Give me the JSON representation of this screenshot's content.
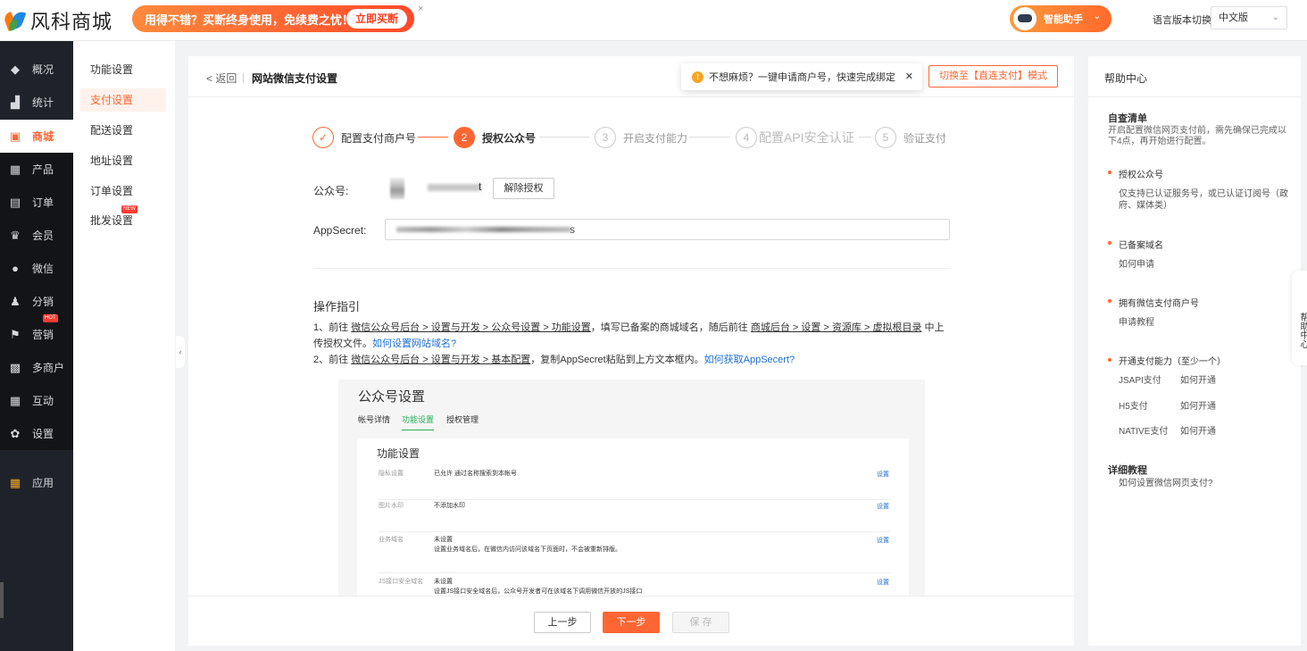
{
  "header": {
    "logo_text": "风科商城",
    "promo_text": "用得不错？买断终身使用，免续费之忧！",
    "promo_button": "立即买断",
    "promo_close": "×",
    "assistant_label": "智能助手",
    "language_label": "语言版本切换：",
    "language_value": "中文版"
  },
  "sidebar": {
    "items": [
      {
        "label": "概况",
        "icon": "◆"
      },
      {
        "label": "统计",
        "icon": "▟"
      },
      {
        "label": "商城",
        "icon": "▣"
      },
      {
        "label": "产品",
        "icon": "▦"
      },
      {
        "label": "订单",
        "icon": "▤"
      },
      {
        "label": "会员",
        "icon": "♛"
      },
      {
        "label": "微信",
        "icon": "●"
      },
      {
        "label": "分销",
        "icon": "♟"
      },
      {
        "label": "营销",
        "icon": "⚑",
        "badge": "HOT"
      },
      {
        "label": "多商户",
        "icon": "▩"
      },
      {
        "label": "互动",
        "icon": "▦"
      },
      {
        "label": "设置",
        "icon": "✿"
      },
      {
        "label": "应用",
        "icon": "▦"
      }
    ]
  },
  "subnav": {
    "items": [
      {
        "label": "功能设置"
      },
      {
        "label": "支付设置"
      },
      {
        "label": "配送设置"
      },
      {
        "label": "地址设置"
      },
      {
        "label": "订单设置"
      },
      {
        "label": "批发设置",
        "badge": "NEW"
      }
    ]
  },
  "main": {
    "back": "< 返回",
    "separator": "|",
    "title": "网站微信支付设置",
    "tip_icon": "!",
    "tip_text": "不想麻烦？一键申请商户号，快速完成绑定",
    "tip_close": "✕",
    "switch_button": "切换至【直连支付】模式",
    "steps": [
      {
        "num": "✓",
        "label": "配置支付商户号"
      },
      {
        "num": "2",
        "label": "授权公众号"
      },
      {
        "num": "3",
        "label": "开启支付能力"
      },
      {
        "num": "4",
        "label": "配置API安全认证"
      },
      {
        "num": "5",
        "label": "验证支付"
      }
    ],
    "form": {
      "account_label": "公众号:",
      "account_name_tail": "t",
      "unbind_button": "解除授权",
      "secret_label": "AppSecret:",
      "secret_tail": "s"
    },
    "guide": {
      "title": "操作指引",
      "line1_prefix": "1、前往",
      "line1_link1": "微信公众号后台 > 设置与开发 > 公众号设置 > 功能设置",
      "line1_mid": "，填写已备案的商城域名，随后前往",
      "line1_link2": "商城后台 > 设置 > 资源库 > 虚拟根目录",
      "line1_suffix": "中上",
      "line1b_text": "传授权文件。",
      "line1b_link": "如何设置网站域名?",
      "line2_prefix": "2、前往",
      "line2_link1": "微信公众号后台 > 设置与开发 > 基本配置",
      "line2_mid": "，复制AppSecret粘贴到上方文本框内。",
      "line2_link2": "如何获取AppSecert?"
    },
    "screenshot": {
      "title": "公众号设置",
      "tabs": [
        "帐号详情",
        "功能设置",
        "授权管理"
      ],
      "card_title": "功能设置",
      "rows": [
        {
          "key": "隐私设置",
          "value": "已允许 通过名称搜索到本帐号",
          "value2": "",
          "action": "设置"
        },
        {
          "key": "图片水印",
          "value": "不添加水印",
          "value2": "",
          "action": "设置"
        },
        {
          "key": "业务域名",
          "value": "未设置",
          "value2": "设置业务域名后，在微信内访问该域名下页面时，不会被重新排版。",
          "action": "设置"
        },
        {
          "key": "JS接口安全域名",
          "value": "未设置",
          "value2": "设置JS接口安全域名后，公众号开发者可在该域名下调用微信开放的JS接口",
          "action": "设置"
        }
      ]
    },
    "footer": {
      "prev": "上一步",
      "next": "下一步",
      "save": "保 存"
    }
  },
  "help": {
    "title": "帮助中心",
    "checklist_title": "自查清单",
    "checklist_desc": "开启配置微信网页支付前，需先确保已完成以下4点，再开始进行配置。",
    "item1_title": "授权公众号",
    "item1_desc": "仅支持已认证服务号，或已认证订阅号（政府、媒体类）",
    "item2_title": "已备案域名",
    "item2_link": "如何申请",
    "item3_title": "拥有微信支付商户号",
    "item3_link": "申请教程",
    "item4_title": "开通支付能力（至少一个）",
    "pay_types": [
      {
        "name": "JSAPI支付",
        "link": "如何开通"
      },
      {
        "name": "H5支付",
        "link": "如何开通"
      },
      {
        "name": "NATIVE支付",
        "link": "如何开通"
      }
    ],
    "tutorial_title": "详细教程",
    "tutorial_link": "如何设置微信网页支付?",
    "side_tab": "帮助中心"
  },
  "colors": {
    "accent": "#ff6633",
    "sidebar_bg": "#1f2329",
    "link": "#1e6fd9"
  }
}
